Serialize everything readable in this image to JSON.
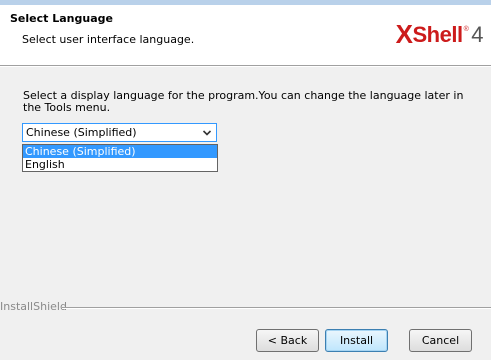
{
  "header": {
    "title": "Select Language",
    "subtitle": "Select user interface language.",
    "logo": {
      "x": "X",
      "shell": "Shell",
      "mark": "®",
      "version": "4"
    }
  },
  "main": {
    "instruction": "Select a display language for the program.You can change the language later in the Tools menu.",
    "language_select": {
      "value": "Chinese (Simplified)",
      "options": [
        {
          "label": "Chinese (Simplified)",
          "highlighted": true
        },
        {
          "label": "English",
          "highlighted": false
        }
      ]
    }
  },
  "footer": {
    "brand": "InstallShield",
    "buttons": {
      "back": "< Back",
      "install": "Install",
      "cancel": "Cancel"
    }
  },
  "colors": {
    "header_bg": "#ffffff",
    "dialog_bg": "#f0f0f0",
    "selection": "#3399ff",
    "logo_red": "#cc1b1b"
  },
  "icons": {
    "dropdown_arrow": "chevron-down-icon"
  }
}
